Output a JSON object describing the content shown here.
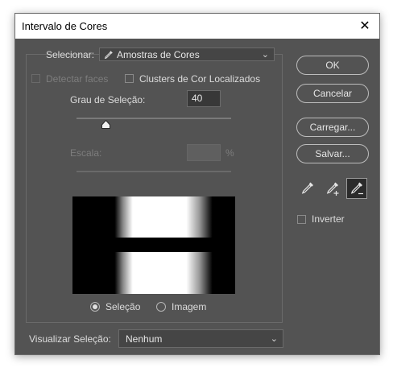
{
  "window": {
    "title": "Intervalo de Cores",
    "close_glyph": "✕"
  },
  "select_row": {
    "label": "Selecionar:",
    "value": "Amostras de Cores",
    "icon": "eyedropper-icon"
  },
  "options": {
    "detect_faces": {
      "label": "Detectar faces",
      "checked": false,
      "enabled": false
    },
    "localized_clusters": {
      "label": "Clusters de Cor Localizados",
      "checked": false
    }
  },
  "fuzziness": {
    "label": "Grau de Seleção:",
    "value": "40",
    "level": 0.2
  },
  "range": {
    "label": "Escala:",
    "value": "",
    "unit": "%",
    "enabled": false
  },
  "preview_mode": {
    "selection_label": "Seleção",
    "image_label": "Imagem",
    "selected": "selection"
  },
  "buttons": {
    "ok": "OK",
    "cancel": "Cancelar",
    "load": "Carregar...",
    "save": "Salvar..."
  },
  "tools": [
    {
      "name": "eyedropper-icon",
      "active": false
    },
    {
      "name": "add-to-sample-eyedropper-icon",
      "active": false
    },
    {
      "name": "subtract-from-sample-eyedropper-icon",
      "active": true
    }
  ],
  "invert": {
    "label": "Inverter",
    "checked": false
  },
  "selection_preview": {
    "label": "Visualizar Seleção:",
    "value": "Nenhum"
  },
  "colors": {
    "dialog_bg": "#535353",
    "field_bg": "#454545",
    "text": "#dcdcdc",
    "disabled": "#7d7d7d"
  }
}
